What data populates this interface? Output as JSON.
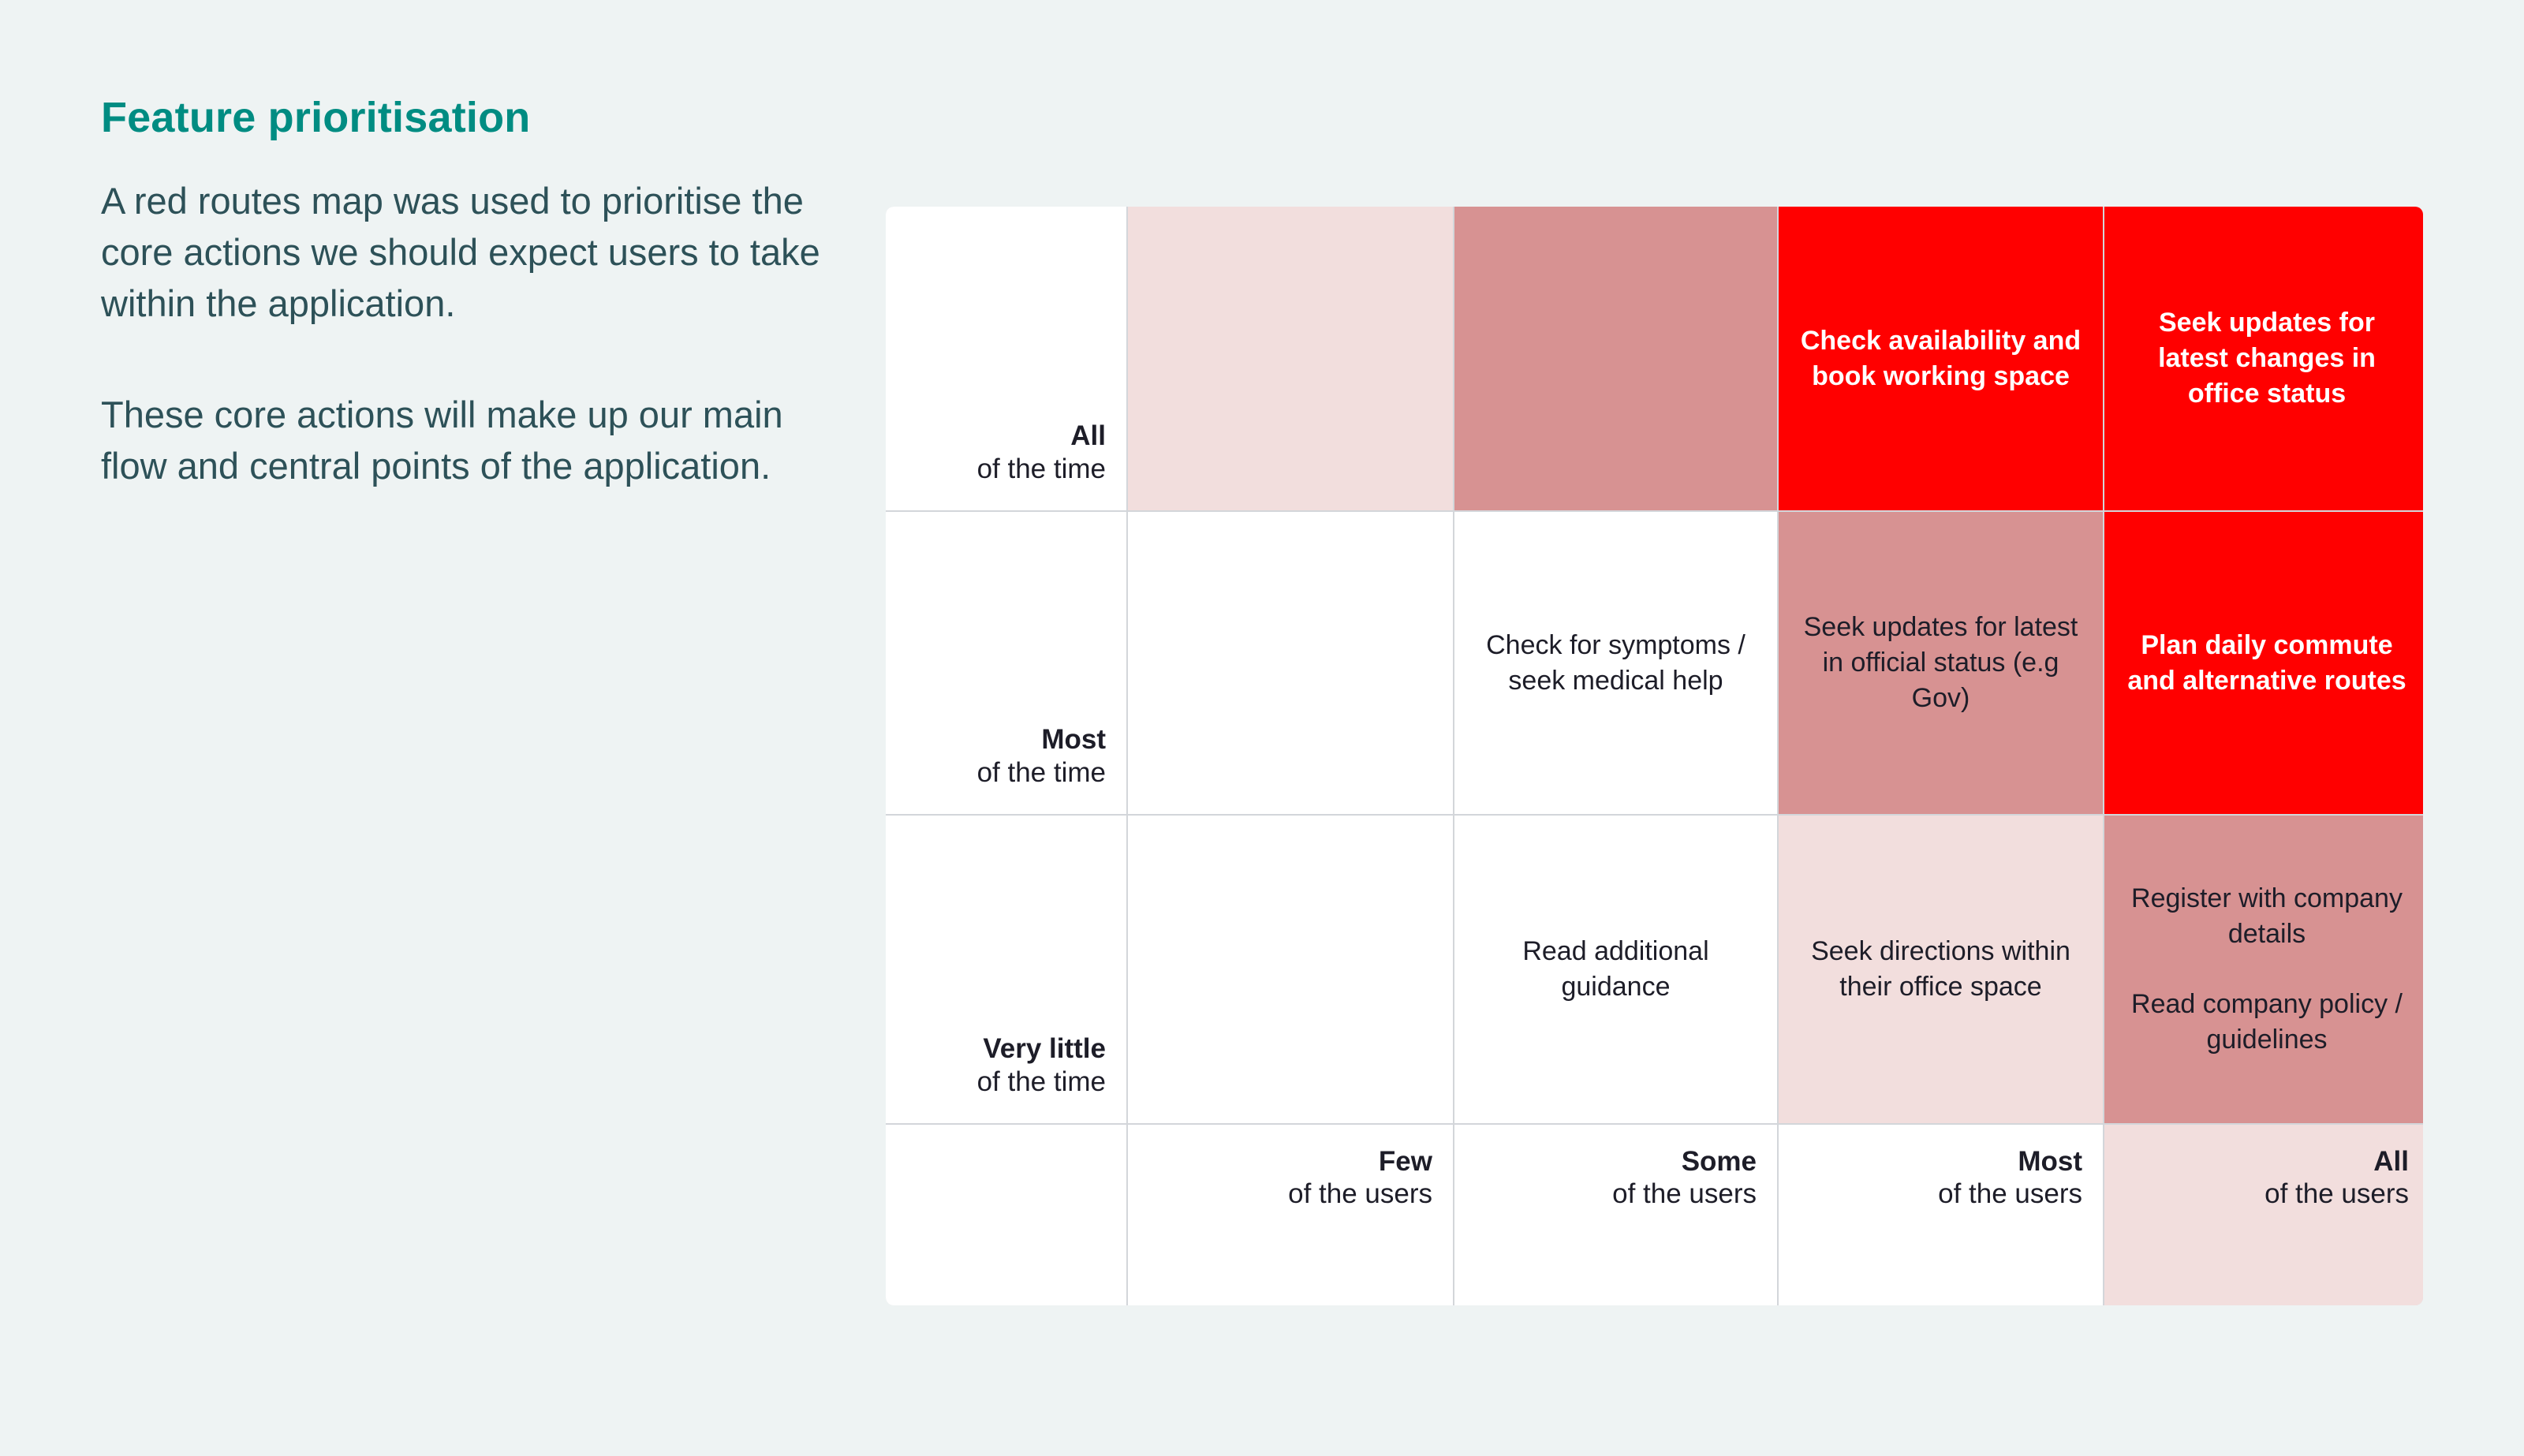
{
  "page": {
    "background_color": "#eef3f3",
    "title": "Feature prioritisation",
    "title_color": "#008c82",
    "paragraph_1": "A red routes map was used to prioritise the core actions we should expect users to take within the application.",
    "paragraph_2": "These core actions will make up our main flow and central points of the application."
  },
  "palette": {
    "none": "#ffffff",
    "light": "#f2dedd",
    "mid": "#d79292",
    "hot": "#ff0000",
    "grid_line": "#d3d6da",
    "text_dark": "#1d1d28",
    "text_on_hot": "#ffffff",
    "body_text": "#2d5158"
  },
  "matrix": {
    "name": "red-routes-map",
    "row_axis": {
      "labels": [
        {
          "strong": "All",
          "weak": "of the time"
        },
        {
          "strong": "Most",
          "weak": "of the time"
        },
        {
          "strong": "Very little",
          "weak": "of the time"
        }
      ]
    },
    "column_axis": {
      "labels": [
        {
          "strong": "Few",
          "weak": "of the users",
          "tinted": false
        },
        {
          "strong": "Some",
          "weak": "of the users",
          "tinted": false
        },
        {
          "strong": "Most",
          "weak": "of the users",
          "tinted": false
        },
        {
          "strong": "All",
          "weak": "of the users",
          "tinted": true
        }
      ]
    },
    "rows": [
      {
        "row_label": "All of the time",
        "cells": [
          {
            "text": "",
            "shade": "light"
          },
          {
            "text": "",
            "shade": "mid"
          },
          {
            "text": "Check availability and book working space",
            "shade": "hot"
          },
          {
            "text": "Seek updates for latest changes in office status",
            "shade": "hot"
          }
        ]
      },
      {
        "row_label": "Most of the time",
        "cells": [
          {
            "text": "",
            "shade": "none"
          },
          {
            "text": "Check for symptoms / seek medical help",
            "shade": "none"
          },
          {
            "text": "Seek updates for latest in official status (e.g Gov)",
            "shade": "mid"
          },
          {
            "text": "Plan daily commute and alternative routes",
            "shade": "hot"
          }
        ]
      },
      {
        "row_label": "Very little of the time",
        "cells": [
          {
            "text": "",
            "shade": "none"
          },
          {
            "text": "Read additional guidance",
            "shade": "none"
          },
          {
            "text": "Seek directions within their office space",
            "shade": "light"
          },
          {
            "text": "Register with company details\n\nRead company policy / guidelines",
            "shade": "mid"
          }
        ]
      }
    ]
  }
}
